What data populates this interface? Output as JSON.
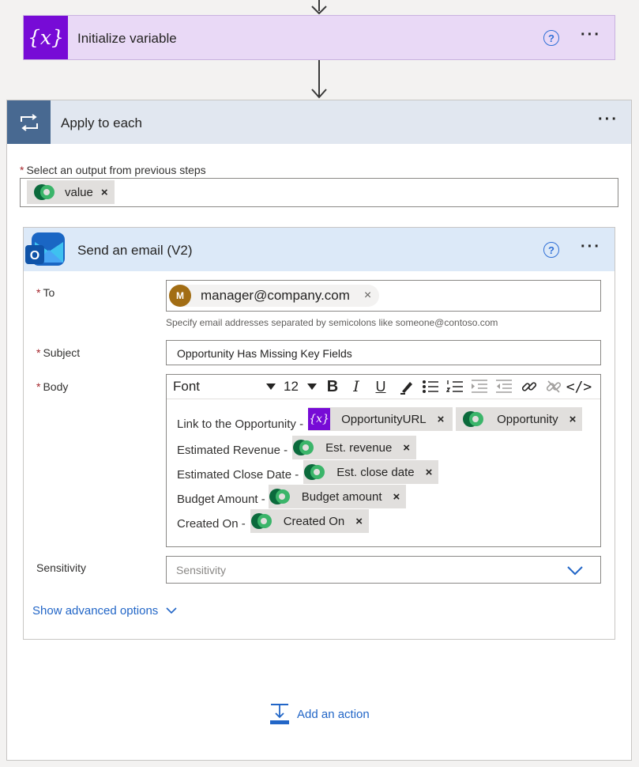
{
  "init_card": {
    "title": "Initialize variable",
    "icon": "{x}",
    "help": "?",
    "more": "···"
  },
  "apply": {
    "title": "Apply to each",
    "more": "···",
    "select_label": "Select an output from previous steps",
    "required_mark": "*",
    "token": {
      "label": "value",
      "close": "×"
    }
  },
  "email": {
    "title": "Send an email (V2)",
    "help": "?",
    "more": "···",
    "to": {
      "label": "To",
      "avatar_initial": "M",
      "email": "manager@company.com",
      "remove": "×",
      "hint": "Specify email addresses separated by semicolons like someone@contoso.com"
    },
    "subject": {
      "label": "Subject",
      "value": "Opportunity Has Missing Key Fields"
    },
    "body": {
      "label": "Body",
      "toolbar": {
        "font": "Font",
        "size": "12",
        "bold": "B",
        "italic": "I",
        "underline": "U",
        "code": "</>"
      },
      "lines": [
        {
          "text": "Link to the Opportunity -",
          "tokens": [
            {
              "kind": "variable",
              "icon": "{x}",
              "label": "OpportunityURL",
              "close": "×"
            },
            {
              "kind": "dataverse",
              "label": "Opportunity",
              "close": "×"
            }
          ]
        },
        {
          "text": "Estimated Revenue -",
          "tokens": [
            {
              "kind": "dataverse",
              "label": "Est. revenue",
              "close": "×"
            }
          ]
        },
        {
          "text": "Estimated Close Date -",
          "tokens": [
            {
              "kind": "dataverse",
              "label": "Est. close date",
              "close": "×"
            }
          ]
        },
        {
          "text": "Budget Amount -",
          "tokens": [
            {
              "kind": "dataverse",
              "label": "Budget amount",
              "close": "×"
            }
          ]
        },
        {
          "text": "Created On -",
          "tokens": [
            {
              "kind": "dataverse",
              "label": "Created On",
              "close": "×"
            }
          ]
        }
      ]
    },
    "sensitivity": {
      "label": "Sensitivity",
      "placeholder": "Sensitivity"
    },
    "advanced": "Show advanced options"
  },
  "add_action": "Add an action",
  "colors": {
    "accent": "#2266c7",
    "variable": "#770bd6",
    "loop": "#486991",
    "required": "#a4262c"
  }
}
